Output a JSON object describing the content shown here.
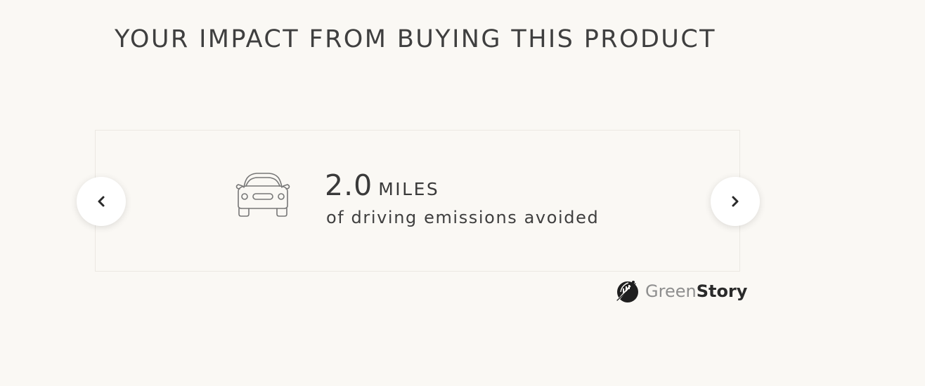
{
  "section": {
    "title": "YOUR IMPACT FROM BUYING THIS PRODUCT"
  },
  "impact": {
    "icon": "car-icon",
    "value": "2.0",
    "unit": "MILES",
    "description": "of driving emissions avoided"
  },
  "carousel": {
    "prev_icon": "chevron-left-icon",
    "next_icon": "chevron-right-icon"
  },
  "brand": {
    "name_part1": "Green",
    "name_part2": "Story",
    "logo_icon": "greenstory-logo-icon"
  },
  "colors": {
    "background": "#faf8f4",
    "text": "#3e3e3e",
    "card_border": "#ebe8e2"
  }
}
